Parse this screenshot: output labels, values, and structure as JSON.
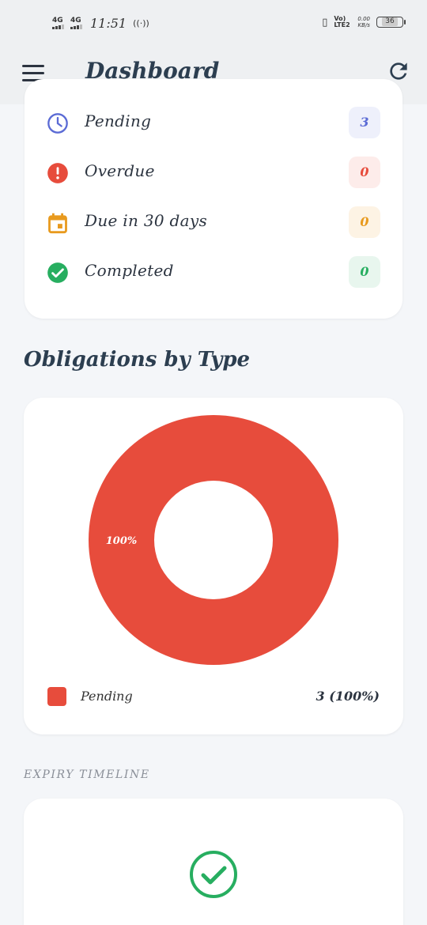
{
  "status_bar": {
    "network1": "4G",
    "network2": "4G",
    "time": "11:51",
    "volte": "Vo) LTE2",
    "speed_value": "0.00",
    "speed_unit": "KB/s",
    "battery": "36"
  },
  "header": {
    "title": "Dashboard",
    "menu_icon": "hamburger-menu-icon",
    "refresh_icon": "refresh-icon"
  },
  "summary": {
    "items": [
      {
        "label": "Pending",
        "count": "3",
        "icon": "clock-icon",
        "color": "#5b6bd5",
        "bg": "#eef0fb"
      },
      {
        "label": "Overdue",
        "count": "0",
        "icon": "alert-icon",
        "color": "#e74c3c",
        "bg": "#fdecea"
      },
      {
        "label": "Due in 30 days",
        "count": "0",
        "icon": "calendar-icon",
        "color": "#e89a1e",
        "bg": "#fdf3e4"
      },
      {
        "label": "Completed",
        "count": "0",
        "icon": "check-circle-icon",
        "color": "#27ae60",
        "bg": "#e8f6ee"
      }
    ]
  },
  "obligations": {
    "title": "Obligations by Type"
  },
  "chart_data": {
    "type": "pie",
    "donut": true,
    "categories": [
      "Pending"
    ],
    "values": [
      3
    ],
    "percent_labels": [
      "100%"
    ],
    "colors": [
      "#e74c3c"
    ],
    "legend": [
      {
        "label": "Pending",
        "value": "3 (100%)"
      }
    ]
  },
  "timeline": {
    "heading": "EXPIRY TIMELINE",
    "empty_icon": "check-circle-icon"
  }
}
